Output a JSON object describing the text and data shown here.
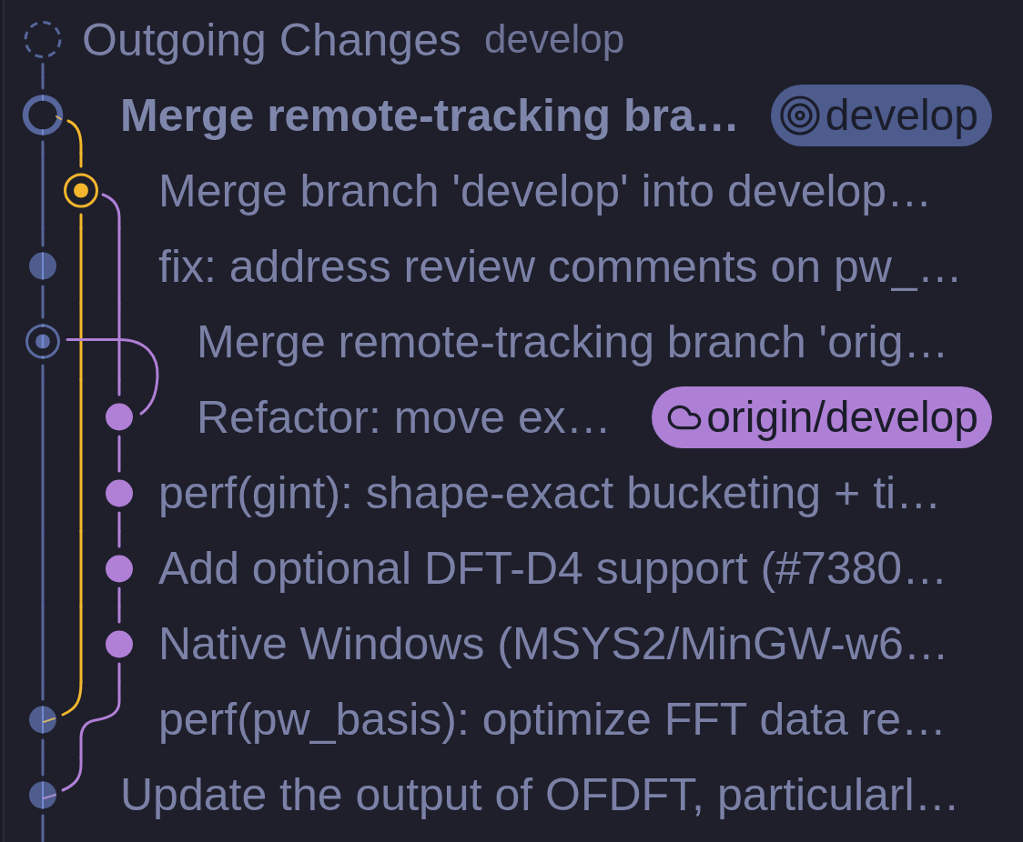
{
  "outgoing": {
    "title": "Outgoing Changes",
    "branch": "develop",
    "color": "#56659b"
  },
  "commits": [
    {
      "kind": "merge",
      "message": "Merge remote-tracking bra…",
      "current": true,
      "color": "#56659b",
      "badges": [
        {
          "kind": "local",
          "label": "develop",
          "color": "#4d5b8d"
        }
      ]
    },
    {
      "kind": "merge",
      "message": "Merge branch 'develop' into develop…",
      "current": false,
      "color": "#f3b62d"
    },
    {
      "kind": "commit",
      "message": "fix: address review comments on pw_…",
      "current": false,
      "color": "#4f5d8e"
    },
    {
      "kind": "merge",
      "message": "Merge remote-tracking branch 'orig…",
      "current": false,
      "color": "#5a6aa0"
    },
    {
      "kind": "commit",
      "message": "Refactor: move ex…",
      "current": false,
      "color": "#b07fd6",
      "badges": [
        {
          "kind": "remote",
          "label": "origin/develop",
          "color": "#ad7fd5"
        }
      ]
    },
    {
      "kind": "commit",
      "message": "perf(gint): shape-exact bucketing + ti…",
      "current": false,
      "color": "#b07fd6"
    },
    {
      "kind": "commit",
      "message": "Add optional DFT-D4 support (#7380…",
      "current": false,
      "color": "#b07fd6"
    },
    {
      "kind": "commit",
      "message": "Native Windows (MSYS2/MinGW-w6…",
      "current": false,
      "color": "#b07fd6"
    },
    {
      "kind": "commit",
      "message": "perf(pw_basis): optimize FFT data re…",
      "current": false,
      "color": "#4f5d8e"
    },
    {
      "kind": "commit",
      "message": "Update the output of OFDFT, particularl…",
      "current": false,
      "color": "#4f5d8e"
    }
  ]
}
